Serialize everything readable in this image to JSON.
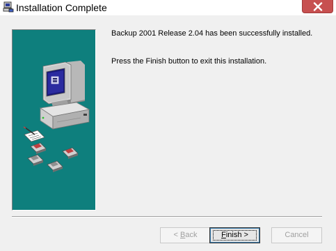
{
  "window": {
    "title": "Installation Complete",
    "icons": {
      "app": "installer-computer-icon",
      "close": "close-icon"
    },
    "colors": {
      "panel": "#0e7f7d",
      "close_button": "#c75050"
    }
  },
  "content": {
    "message_1": "Backup 2001 Release 2.04 has been successfully installed.",
    "message_2": "Press the Finish button to exit this installation."
  },
  "side_panel": {
    "illustration": "computer-with-floppy-disks"
  },
  "buttons": {
    "back": {
      "pre": "< ",
      "mnemonic": "B",
      "rest": "ack",
      "enabled": false
    },
    "finish": {
      "mnemonic": "F",
      "rest": "inish >",
      "enabled": true
    },
    "cancel": {
      "label": "Cancel",
      "enabled": false
    }
  }
}
